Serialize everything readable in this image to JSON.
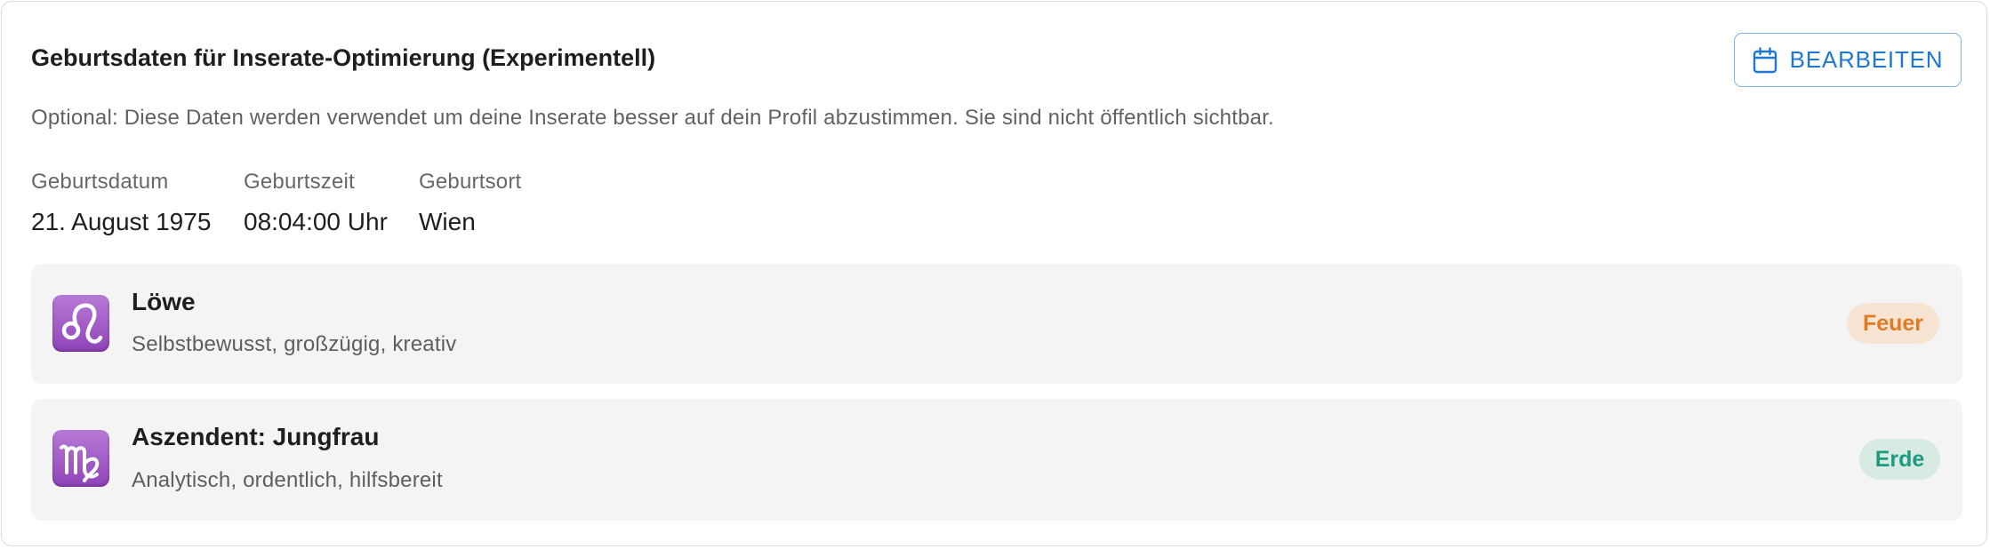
{
  "panel": {
    "title": "Geburtsdaten für Inserate-Optimierung (Experimentell)",
    "edit_button": {
      "label": "BEARBEITEN",
      "icon": "calendar-icon"
    },
    "description": "Optional: Diese Daten werden verwendet um deine Inserate besser auf dein Profil abzustimmen. Sie sind nicht öffentlich sichtbar."
  },
  "birth_fields": [
    {
      "label": "Geburtsdatum",
      "value": "21. August 1975"
    },
    {
      "label": "Geburtszeit",
      "value": "08:04:00 Uhr"
    },
    {
      "label": "Geburtsort",
      "value": "Wien"
    }
  ],
  "signs": [
    {
      "icon": "leo-zodiac-icon",
      "name": "Löwe",
      "traits": "Selbstbewusst, großzügig, kreativ",
      "element": "Feuer",
      "element_color": "#e07b24",
      "element_bg": "#f8e4d3"
    },
    {
      "icon": "virgo-zodiac-icon",
      "name": "Aszendent: Jungfrau",
      "traits": "Analytisch, ordentlich, hilfsbereit",
      "element": "Erde",
      "element_color": "#1f9a7f",
      "element_bg": "#d7ebe4"
    }
  ],
  "colors": {
    "accent": "#1f77d4",
    "card_bg": "#f4f4f4",
    "zodiac_icon_bg": "#9b4fc4"
  }
}
